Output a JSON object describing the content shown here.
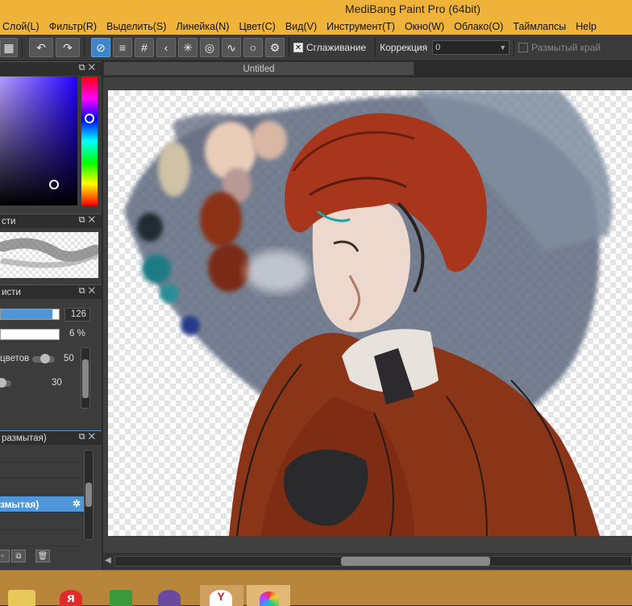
{
  "window": {
    "title": "MediBang Paint Pro (64bit)"
  },
  "menu": [
    "Слой(L)",
    "Фильтр(R)",
    "Выделить(S)",
    "Линейка(N)",
    "Цвет(C)",
    "Вид(V)",
    "Инструмент(T)",
    "Окно(W)",
    "Облако(O)",
    "Таймлапсы",
    "Help"
  ],
  "toolbar": {
    "antialias_label": "Сглаживание",
    "antialias_checked": true,
    "correction_label": "Коррекция",
    "correction_value": "0",
    "blur_edge_label": "Размытый край",
    "blur_edge_checked": false
  },
  "panels": {
    "brush_preview_title": "сти",
    "brush_title": "исти",
    "brush_size_value": "126",
    "brush_size_percent": 0.97,
    "brush_opacity_value": "6 %",
    "color_mix_label": "цветов",
    "color_mix_value": "50",
    "color_mix_fraction": 0.5,
    "second_slider_value": "30",
    "second_slider_fraction": 0.3,
    "layers_title": "размытая)",
    "selected_layer": "змытая)"
  },
  "document": {
    "tab_title": "Untitled"
  },
  "colors": {
    "accent": "#4f97d8",
    "titlebar": "#f0b33a",
    "panel": "#3c3c3c",
    "taskbar": "#b7863a"
  }
}
